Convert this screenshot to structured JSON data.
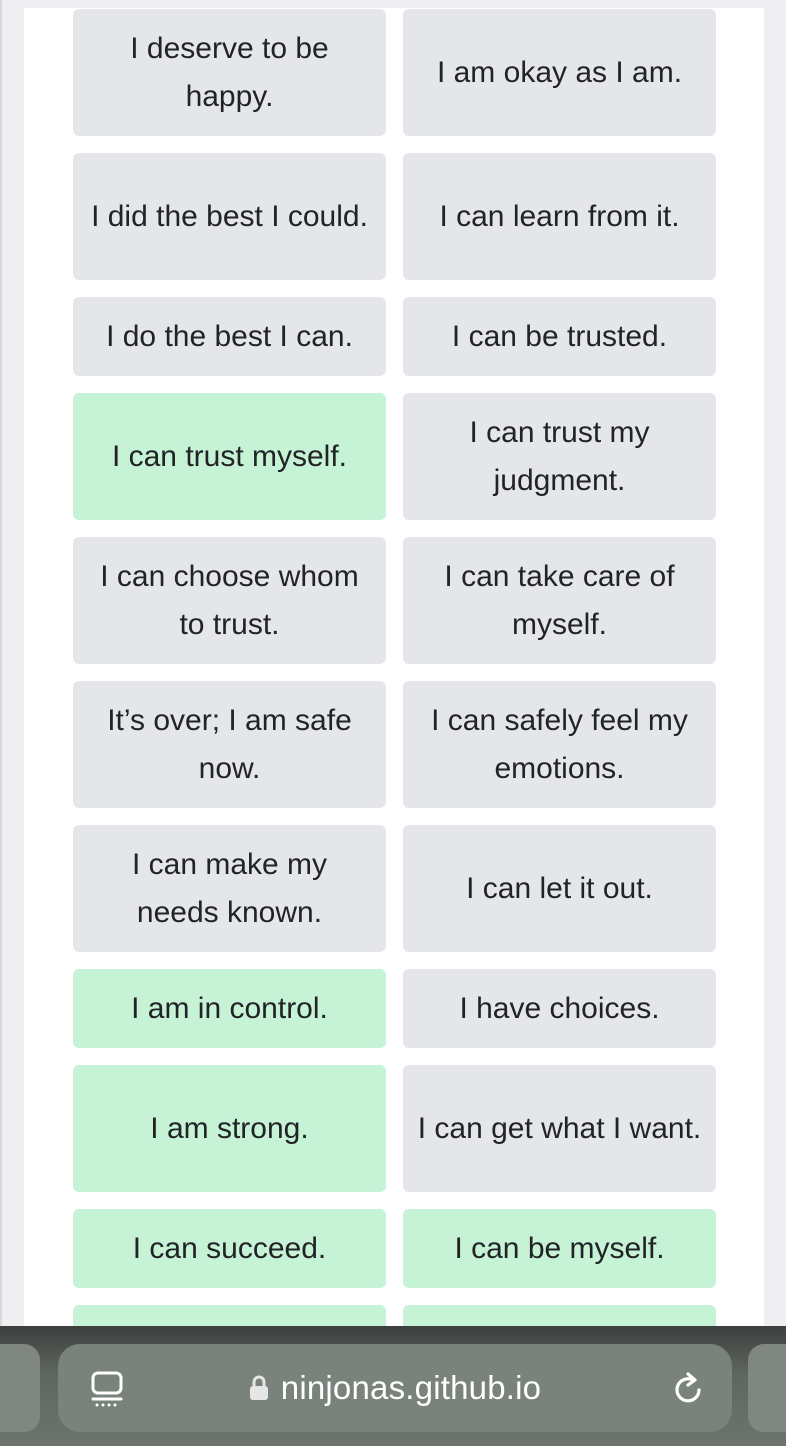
{
  "affirmations": [
    {
      "text": "I deserve to be happy.",
      "selected": false
    },
    {
      "text": "I am okay as I am.",
      "selected": false
    },
    {
      "text": "I did the best I could.",
      "selected": false
    },
    {
      "text": "I can learn from it.",
      "selected": false
    },
    {
      "text": "I do the best I can.",
      "selected": false
    },
    {
      "text": "I can be trusted.",
      "selected": false
    },
    {
      "text": "I can trust myself.",
      "selected": true
    },
    {
      "text": "I can trust my judgment.",
      "selected": false
    },
    {
      "text": "I can choose whom to trust.",
      "selected": false
    },
    {
      "text": "I can take care of myself.",
      "selected": false
    },
    {
      "text": "It’s over; I am safe now.",
      "selected": false
    },
    {
      "text": "I can safely feel my emotions.",
      "selected": false
    },
    {
      "text": "I can make my needs known.",
      "selected": false
    },
    {
      "text": "I can let it out.",
      "selected": false
    },
    {
      "text": "I am in control.",
      "selected": true
    },
    {
      "text": "I have choices.",
      "selected": false
    },
    {
      "text": "I am strong.",
      "selected": true
    },
    {
      "text": "I can get what I want.",
      "selected": false
    },
    {
      "text": "I can succeed.",
      "selected": true
    },
    {
      "text": "I can be myself.",
      "selected": true
    },
    {
      "text": "",
      "selected": true
    },
    {
      "text": "",
      "selected": true
    }
  ],
  "colors": {
    "tile_default": "#e5e6ea",
    "tile_selected": "#c6f2d5",
    "text": "#212326"
  },
  "browser": {
    "url": "ninjonas.github.io",
    "tabs_icon": "tabs-overview-icon",
    "lock_icon": "lock-icon",
    "reload_icon": "reload-icon"
  }
}
